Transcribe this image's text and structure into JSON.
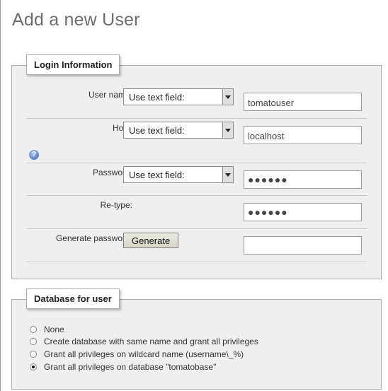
{
  "page": {
    "title": "Add a new User"
  },
  "login": {
    "legend": "Login Information",
    "username": {
      "label": "User name:",
      "select_value": "Use text field:",
      "value": "tomatouser"
    },
    "host": {
      "label": "Host:",
      "select_value": "Use text field:",
      "value": "localhost"
    },
    "password": {
      "label": "Password:",
      "select_value": "Use text field:",
      "value": "●●●●●●"
    },
    "retype": {
      "label": "Re-type:",
      "value": "●●●●●●"
    },
    "generate": {
      "label": "Generate password:",
      "button": "Generate",
      "value": ""
    }
  },
  "database": {
    "legend": "Database for user",
    "options": [
      {
        "label": "None",
        "checked": false
      },
      {
        "label": "Create database with same name and grant all privileges",
        "checked": false
      },
      {
        "label": "Grant all privileges on wildcard name (username\\_%)",
        "checked": false
      },
      {
        "label": "Grant all privileges on database \"tomatobase\"",
        "checked": true
      }
    ]
  }
}
